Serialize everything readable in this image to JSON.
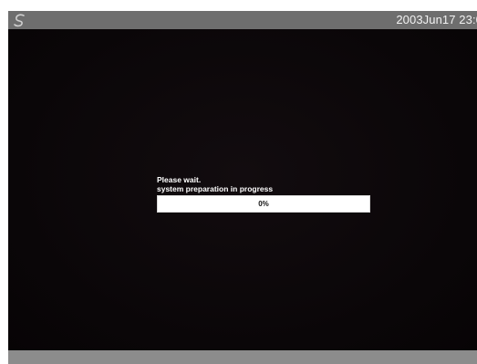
{
  "topbar": {
    "logo_icon": "swirl-logo-icon",
    "datetime": "2003Jun17 23:0"
  },
  "dialog": {
    "line1": "Please wait.",
    "line2": "system preparation in progress",
    "progress_label": "0%",
    "progress_fraction": 0
  },
  "colors": {
    "screen_background": "#0b0709",
    "topbar": "#6e6e6e",
    "progress_background": "#ffffff",
    "text": "#ffffff"
  }
}
